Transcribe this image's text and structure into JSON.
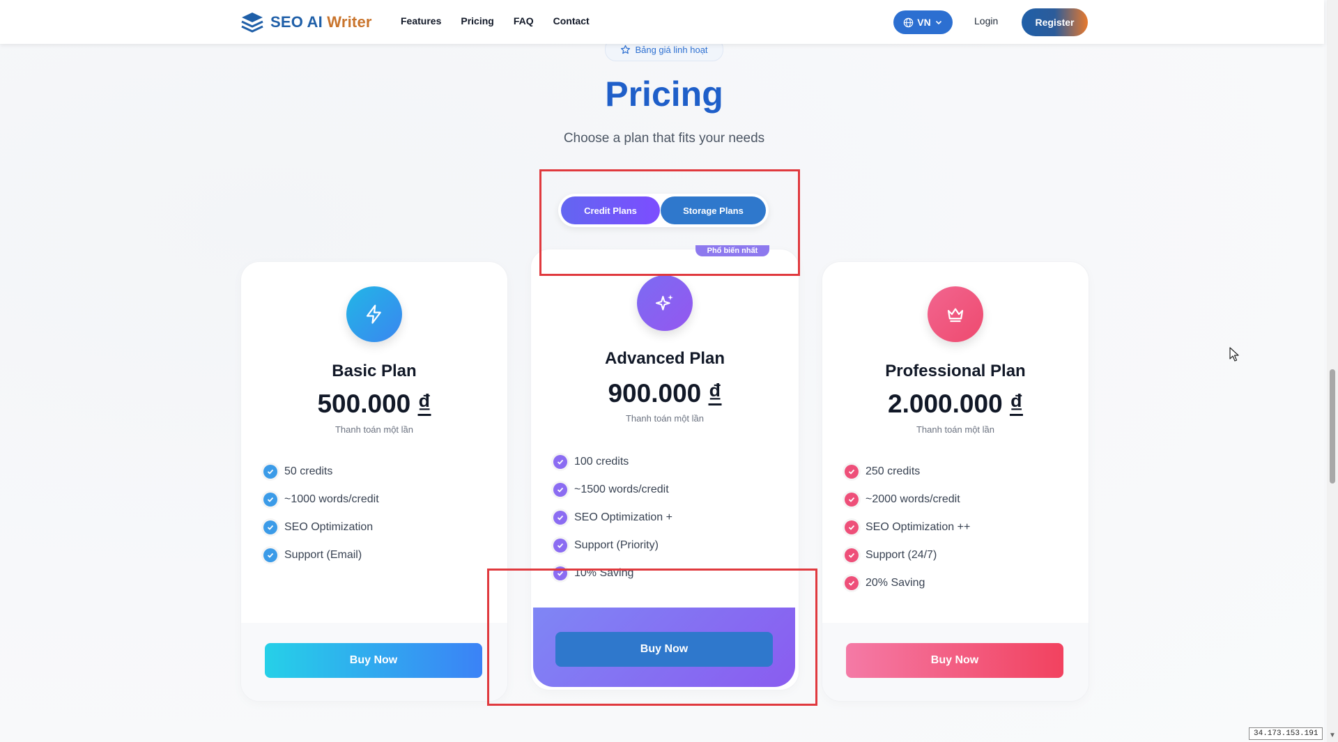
{
  "header": {
    "logo_text_1": "SEO AI",
    "logo_text_2": "Writer",
    "nav": [
      "Features",
      "Pricing",
      "FAQ",
      "Contact"
    ],
    "lang": "VN",
    "login": "Login",
    "register": "Register"
  },
  "hero": {
    "badge": "Bảng giá linh hoạt",
    "title": "Pricing",
    "subtitle": "Choose a plan that fits your needs"
  },
  "toggle": {
    "credit": "Credit Plans",
    "storage": "Storage Plans",
    "active": "credit"
  },
  "plans": [
    {
      "name": "Basic Plan",
      "price": "500.000",
      "currency": "₫",
      "note": "Thanh toán một lần",
      "features": [
        "50 credits",
        "~1000 words/credit",
        "SEO Optimization",
        "Support (Email)"
      ],
      "button": "Buy Now",
      "icon": "lightning-icon",
      "color": "#3b9be8"
    },
    {
      "name": "Advanced Plan",
      "badge": "Phổ biến nhất",
      "price": "900.000",
      "currency": "₫",
      "note": "Thanh toán một lần",
      "features": [
        "100 credits",
        "~1500 words/credit",
        "SEO Optimization +",
        "Support (Priority)",
        "10% Saving"
      ],
      "button": "Buy Now",
      "icon": "sparkles-icon",
      "color": "#8b6cf2"
    },
    {
      "name": "Professional Plan",
      "price": "2.000.000",
      "currency": "₫",
      "note": "Thanh toán một lần",
      "features": [
        "250 credits",
        "~2000 words/credit",
        "SEO Optimization ++",
        "Support (24/7)",
        "20% Saving"
      ],
      "button": "Buy Now",
      "icon": "crown-icon",
      "color": "#ee4f79"
    }
  ],
  "ip": "34.173.153.191"
}
